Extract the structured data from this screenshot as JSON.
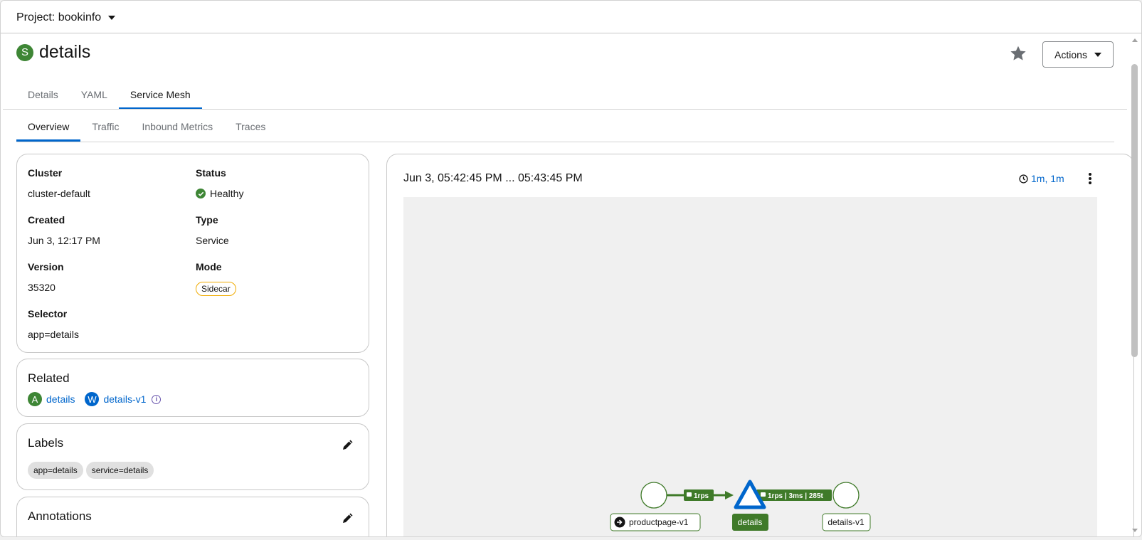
{
  "project": {
    "label": "Project: bookinfo"
  },
  "resource": {
    "badge": "S",
    "name": "details"
  },
  "header": {
    "actions_label": "Actions"
  },
  "tabs": [
    "Details",
    "YAML",
    "Service Mesh"
  ],
  "subtabs": [
    "Overview",
    "Traffic",
    "Inbound Metrics",
    "Traces"
  ],
  "info": {
    "cluster_label": "Cluster",
    "cluster_value": "cluster-default",
    "status_label": "Status",
    "status_value": "Healthy",
    "created_label": "Created",
    "created_value": "Jun 3, 12:17 PM",
    "type_label": "Type",
    "type_value": "Service",
    "version_label": "Version",
    "version_value": "35320",
    "mode_label": "Mode",
    "mode_value": "Sidecar",
    "selector_label": "Selector",
    "selector_value": "app=details"
  },
  "related": {
    "title": "Related",
    "items": [
      {
        "badge": "A",
        "name": "details",
        "color": "#3e8635"
      },
      {
        "badge": "W",
        "name": "details-v1",
        "color": "#0066cc"
      }
    ],
    "info_glyph": "i"
  },
  "labels": {
    "title": "Labels",
    "chips": [
      "app=details",
      "service=details"
    ]
  },
  "annotations": {
    "title": "Annotations"
  },
  "graph": {
    "time_range": "Jun 3, 05:42:45 PM ... 05:43:45 PM",
    "duration": "1m, 1m",
    "nodes": {
      "productpage": "productpage-v1",
      "service": "details",
      "workload": "details-v1"
    },
    "edges": {
      "in": "1rps",
      "out": "1rps | 3ms | 285t"
    }
  },
  "colors": {
    "accent": "#0066cc",
    "success": "#3e8635",
    "mesh_green": "#3f7a29",
    "warning_border": "#f0ab00"
  }
}
